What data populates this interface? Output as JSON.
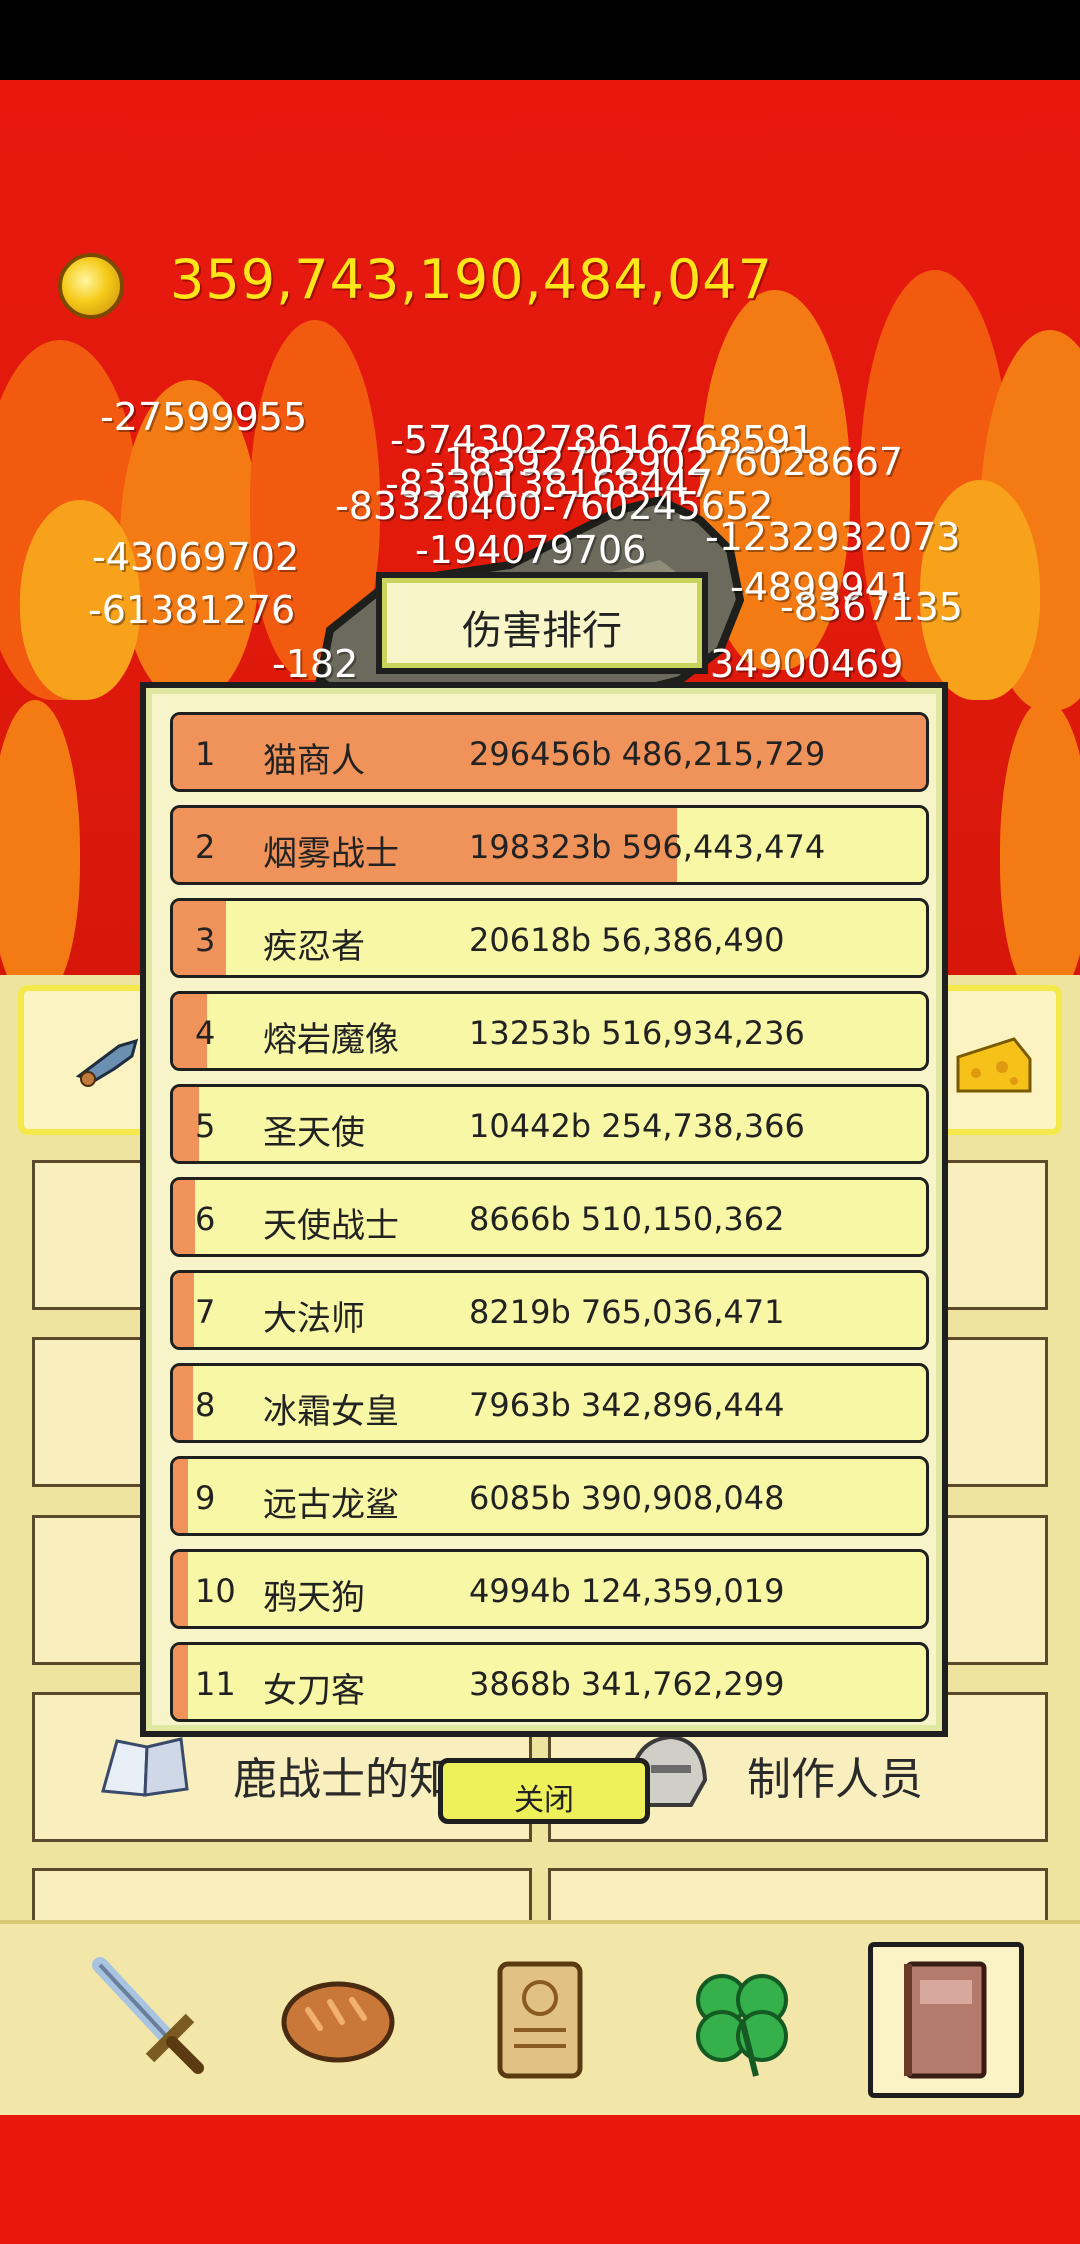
{
  "coins": "359,743,190,484,047",
  "damage_popups": [
    "-27599955",
    "-57430278616768591",
    "-1839270290276028667",
    "-8330138168447",
    "-83320400-760245652",
    "-1232932073",
    "-43069702",
    "-194079706",
    "-61381276",
    "-4899941",
    "-8367135",
    "-182",
    "34900469"
  ],
  "modal": {
    "title": "伤害排行",
    "close_label": "关闭",
    "rows": [
      {
        "rank": "1",
        "name": "猫商人",
        "damage": "296456b 486,215,729",
        "share": 1.0
      },
      {
        "rank": "2",
        "name": "烟雾战士",
        "damage": "198323b 596,443,474",
        "share": 0.669
      },
      {
        "rank": "3",
        "name": "疾忍者",
        "damage": "20618b 56,386,490",
        "share": 0.07
      },
      {
        "rank": "4",
        "name": "熔岩魔像",
        "damage": "13253b 516,934,236",
        "share": 0.045
      },
      {
        "rank": "5",
        "name": "圣天使",
        "damage": "10442b 254,738,366",
        "share": 0.035
      },
      {
        "rank": "6",
        "name": "天使战士",
        "damage": "8666b 510,150,362",
        "share": 0.029
      },
      {
        "rank": "7",
        "name": "大法师",
        "damage": "8219b 765,036,471",
        "share": 0.028
      },
      {
        "rank": "8",
        "name": "冰霜女皇",
        "damage": "7963b 342,896,444",
        "share": 0.027
      },
      {
        "rank": "9",
        "name": "远古龙鲨",
        "damage": "6085b 390,908,048",
        "share": 0.02
      },
      {
        "rank": "10",
        "name": "鸦天狗",
        "damage": "4994b 124,359,019",
        "share": 0.017
      },
      {
        "rank": "11",
        "name": "女刀客",
        "damage": "3868b 341,762,299",
        "share": 0.013
      }
    ]
  },
  "menu": {
    "knowledge_label": "鹿战士的知识",
    "credits_label": "制作人员"
  },
  "nav": {
    "items": [
      "sword-icon",
      "bread-icon",
      "scroll-icon",
      "clover-icon",
      "book-icon"
    ],
    "selected": "book-icon"
  },
  "colors": {
    "scene_red": "#e8180f",
    "coin_text": "#ffe61a",
    "row_fill": "#f0935a",
    "row_bg": "#f7f7a6",
    "close_button": "#eef15a"
  }
}
